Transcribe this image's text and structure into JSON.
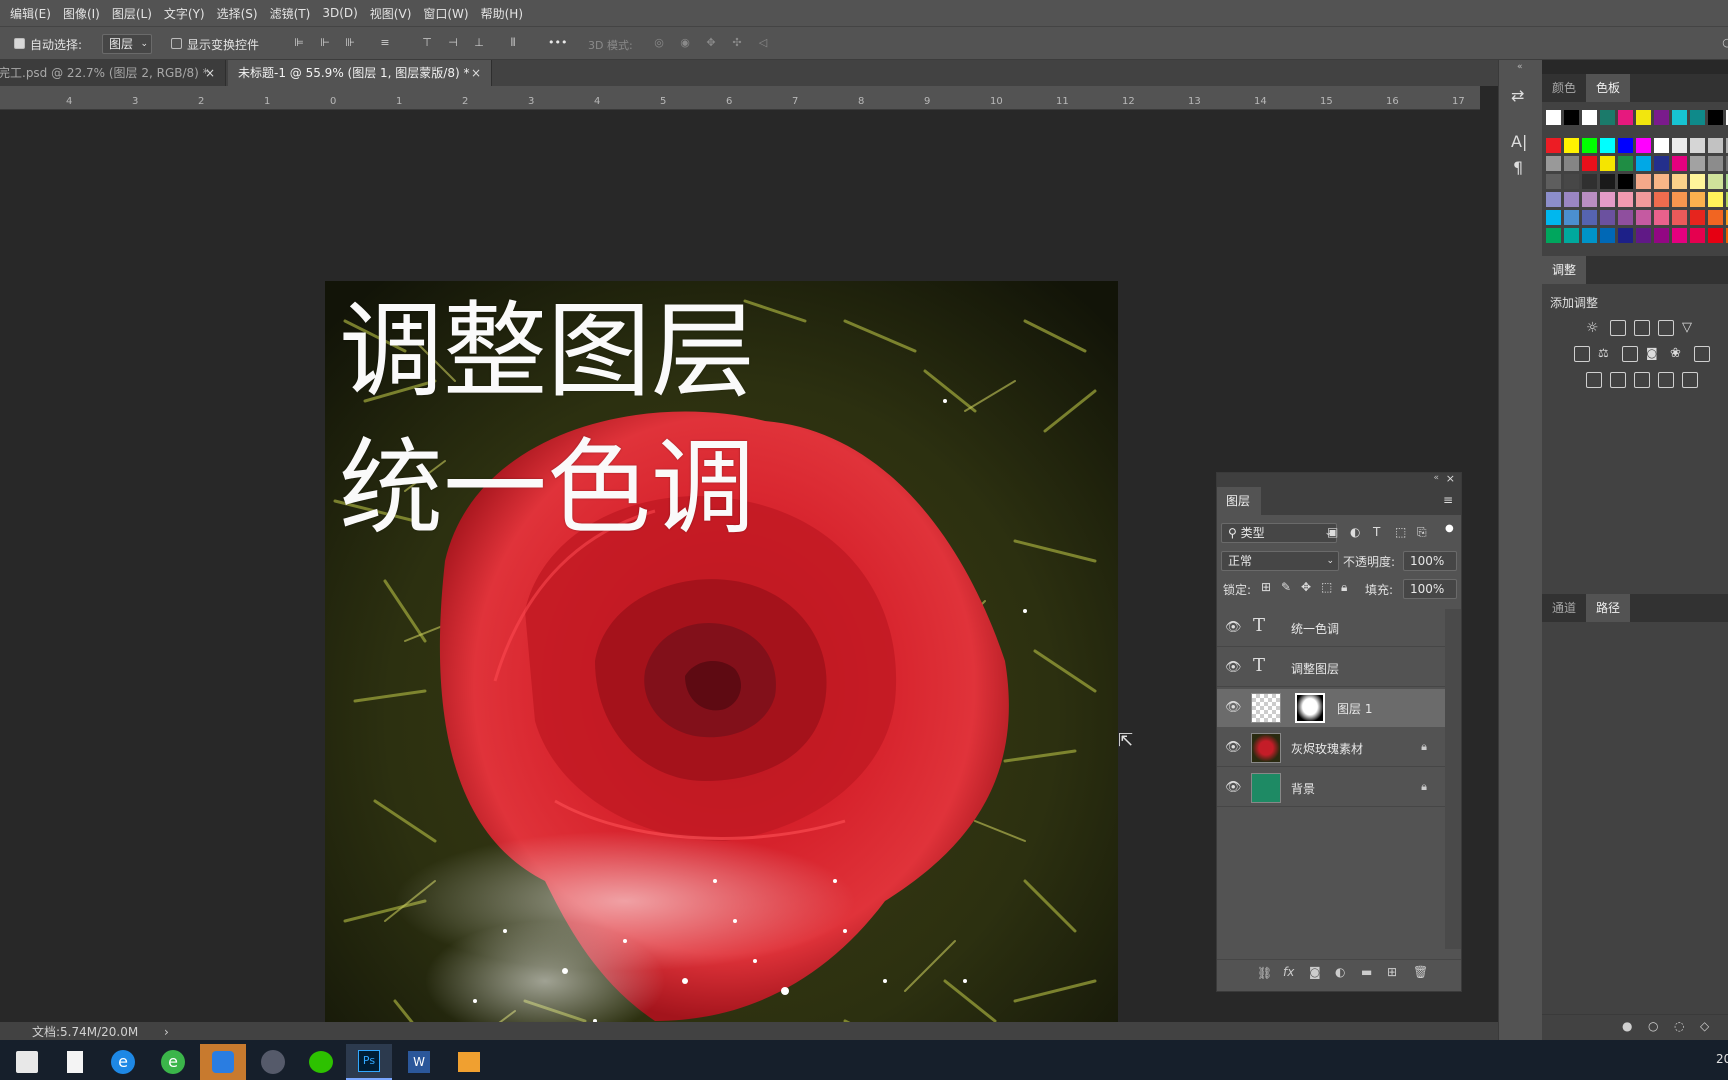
{
  "menu": [
    "编辑(E)",
    "图像(I)",
    "图层(L)",
    "文字(Y)",
    "选择(S)",
    "滤镜(T)",
    "3D(D)",
    "视图(V)",
    "窗口(W)",
    "帮助(H)"
  ],
  "options": {
    "auto_select_label": "自动选择:",
    "auto_select_value": "图层",
    "show_transform_label": "显示变换控件",
    "mode_3d_label": "3D 模式:",
    "more": "•••"
  },
  "tabs": [
    {
      "label": "完工.psd @ 22.7% (图层 2, RGB/8) *",
      "active": false
    },
    {
      "label": "未标题-1 @ 55.9% (图层 1, 图层蒙版/8) *",
      "active": true
    }
  ],
  "ruler_ticks": [
    "4",
    "3",
    "2",
    "1",
    "0",
    "1",
    "2",
    "3",
    "4",
    "5",
    "6",
    "7",
    "8",
    "9",
    "10",
    "11",
    "12",
    "13",
    "14",
    "15",
    "16",
    "17"
  ],
  "canvas": {
    "line1": "调整图层",
    "line2": "统一色调"
  },
  "status": {
    "doc": "文档:5.74M/20.0M",
    "arrow": "›"
  },
  "right_panel": {
    "tabs_top": [
      {
        "label": "颜色",
        "active": false
      },
      {
        "label": "色板",
        "active": true
      }
    ],
    "adjust_tab": "调整",
    "add_adjust": "添加调整",
    "tabs_bottom": [
      {
        "label": "通道",
        "active": false
      },
      {
        "label": "路径",
        "active": true
      }
    ],
    "swatch_colors": [
      [
        "#ffffff",
        "#000000",
        "#ffffff",
        "#1b7a6a",
        "#e6197e",
        "#f2e60e",
        "#7a1b8c",
        "#17c3d2",
        "#0f8a8a",
        "#000000",
        "#ffffff"
      ],
      [
        "#ed1c24",
        "#fff200",
        "#00ff00",
        "#00ffff",
        "#0000ff",
        "#ff00ff",
        "#ffffff",
        "#ebebeb",
        "#d6d6d6",
        "#c2c2c2",
        "#adadad"
      ],
      [
        "#999999",
        "#858585",
        "#e8101b",
        "#f5e500",
        "#1f8d44",
        "#00a8e6",
        "#232f8c",
        "#e4007f",
        "#a2a2a2",
        "#8c8c8c",
        "#767676"
      ],
      [
        "#5e5e5e",
        "#474747",
        "#303030",
        "#1a1a1a",
        "#000000",
        "#f4a98a",
        "#f7b587",
        "#fbd18a",
        "#fff59a",
        "#cfe29a",
        "#a8d58e"
      ],
      [
        "#8c8ecb",
        "#9a86c3",
        "#b98ec2",
        "#e39bc7",
        "#f29ab0",
        "#f29a9b",
        "#ef6c4e",
        "#f7964f",
        "#fbb04e",
        "#fff25a",
        "#b5d35a"
      ],
      [
        "#00b7ee",
        "#4b8fcf",
        "#5664b0",
        "#6b519f",
        "#8f4f9e",
        "#c55aa1",
        "#e9618c",
        "#ea5a5a",
        "#e6251e",
        "#f16522",
        "#f99d1c"
      ],
      [
        "#00a65d",
        "#00a99d",
        "#0094c8",
        "#0068b6",
        "#1d2088",
        "#601986",
        "#920783",
        "#e4007f",
        "#e5004f",
        "#e60012",
        "#eb6100"
      ]
    ]
  },
  "layers_panel": {
    "title": "图层",
    "filter_label": "类型",
    "blend_mode": "正常",
    "opacity_label": "不透明度:",
    "opacity_value": "100%",
    "lock_label": "锁定:",
    "fill_label": "填充:",
    "fill_value": "100%",
    "layers": [
      {
        "name": "统一色调",
        "kind": "text",
        "locked": false,
        "selected": false
      },
      {
        "name": "调整图层",
        "kind": "text",
        "locked": false,
        "selected": false
      },
      {
        "name": "图层 1",
        "kind": "mask",
        "locked": false,
        "selected": true
      },
      {
        "name": "灰烬玫瑰素材",
        "kind": "image",
        "locked": true,
        "selected": false
      },
      {
        "name": "背景",
        "kind": "fill",
        "locked": true,
        "selected": false,
        "color": "#1e8a64"
      }
    ]
  },
  "clock_partial": "20"
}
